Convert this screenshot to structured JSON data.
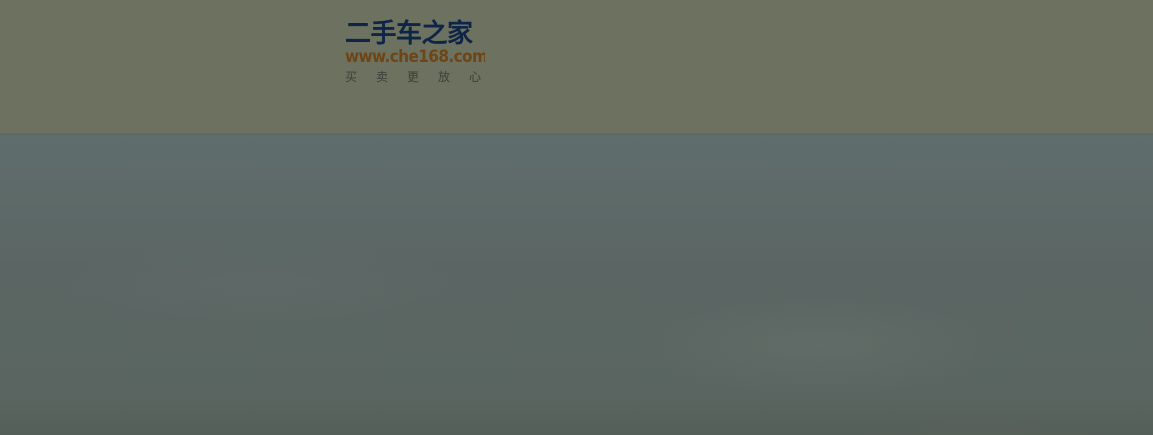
{
  "header": {
    "logo": {
      "name": "二手车之家",
      "url": "www.che168.com",
      "slogan": "买卖更放心"
    }
  }
}
